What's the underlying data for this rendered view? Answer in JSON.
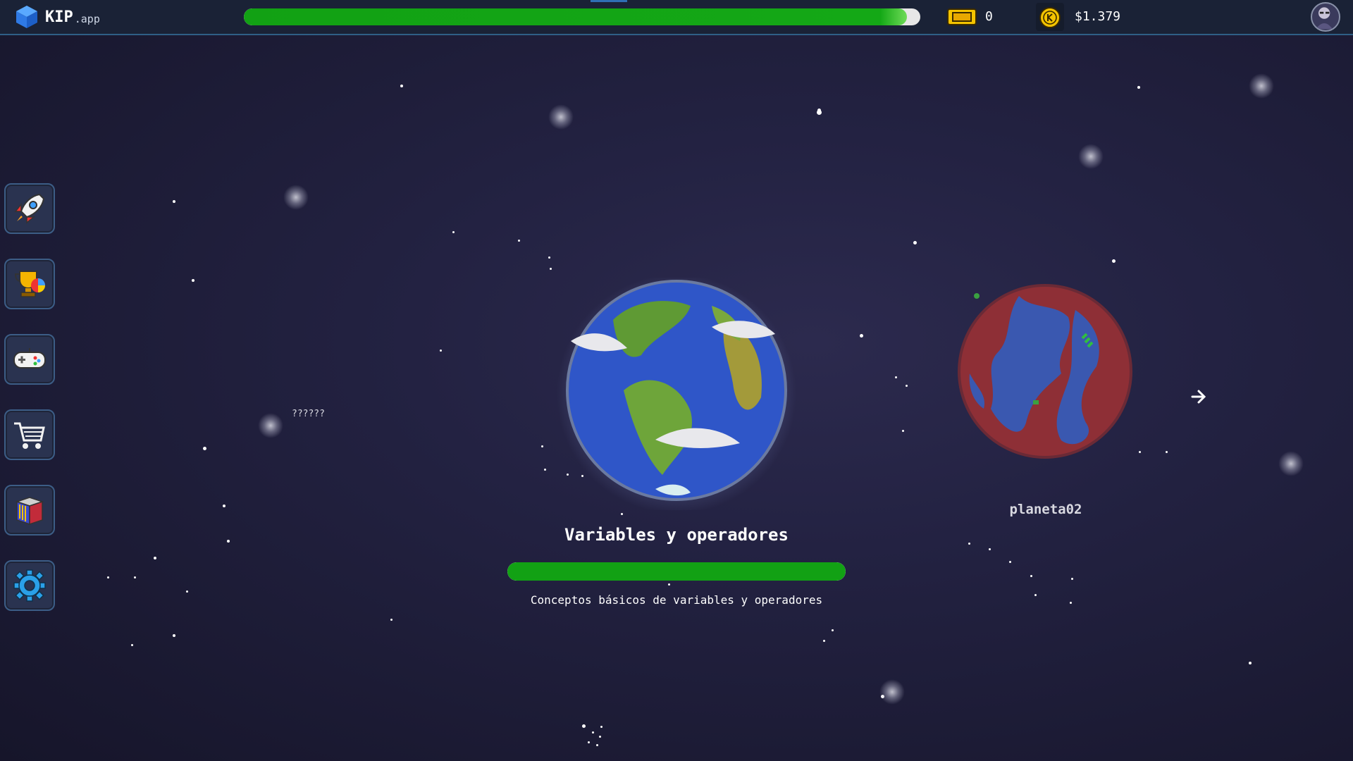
{
  "app": {
    "name": "KIP",
    "suffix": ".app"
  },
  "topbar": {
    "progress_percent": 98,
    "tickets": "0",
    "balance": "$1.379"
  },
  "sidebar": {
    "items": [
      {
        "name": "rocket",
        "icon": "rocket-icon"
      },
      {
        "name": "achievements",
        "icon": "trophy-icon"
      },
      {
        "name": "games",
        "icon": "gamepad-icon"
      },
      {
        "name": "shop",
        "icon": "cart-icon"
      },
      {
        "name": "library",
        "icon": "books-icon"
      },
      {
        "name": "settings",
        "icon": "gear-icon"
      }
    ]
  },
  "planets": {
    "current": {
      "title": "Variables y operadores",
      "description": "Conceptos básicos de variables y operadores",
      "progress_percent": 100
    },
    "next": {
      "label": "planeta02"
    },
    "locked": {
      "label": "??????"
    }
  },
  "colors": {
    "progress": "#12a114",
    "accent_blue": "#2f5f86",
    "coin": "#f5c400"
  }
}
